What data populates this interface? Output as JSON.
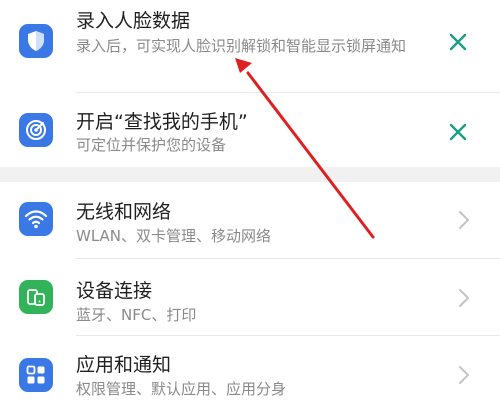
{
  "notices": [
    {
      "title": "录入人脸数据",
      "subtitle": "录入后，可实现人脸识别解锁和智能显示锁屏通知",
      "icon": "face-shield-icon",
      "dismiss_icon": "close-icon"
    },
    {
      "title": "开启“查找我的手机”",
      "subtitle": "可定位并保护您的设备",
      "icon": "radar-icon",
      "dismiss_icon": "close-icon"
    }
  ],
  "settings": [
    {
      "title": "无线和网络",
      "subtitle": "WLAN、双卡管理、移动网络",
      "icon": "wifi-icon"
    },
    {
      "title": "设备连接",
      "subtitle": "蓝牙、NFC、打印",
      "icon": "device-connection-icon"
    },
    {
      "title": "应用和通知",
      "subtitle": "权限管理、默认应用、应用分身",
      "icon": "apps-grid-icon"
    }
  ],
  "colors": {
    "accent_teal": "#199e86",
    "icon_blue": "#3a78e6",
    "icon_green": "#32b35a",
    "annotation_arrow": "#e02020",
    "section_gap": "#f1f1f1"
  }
}
